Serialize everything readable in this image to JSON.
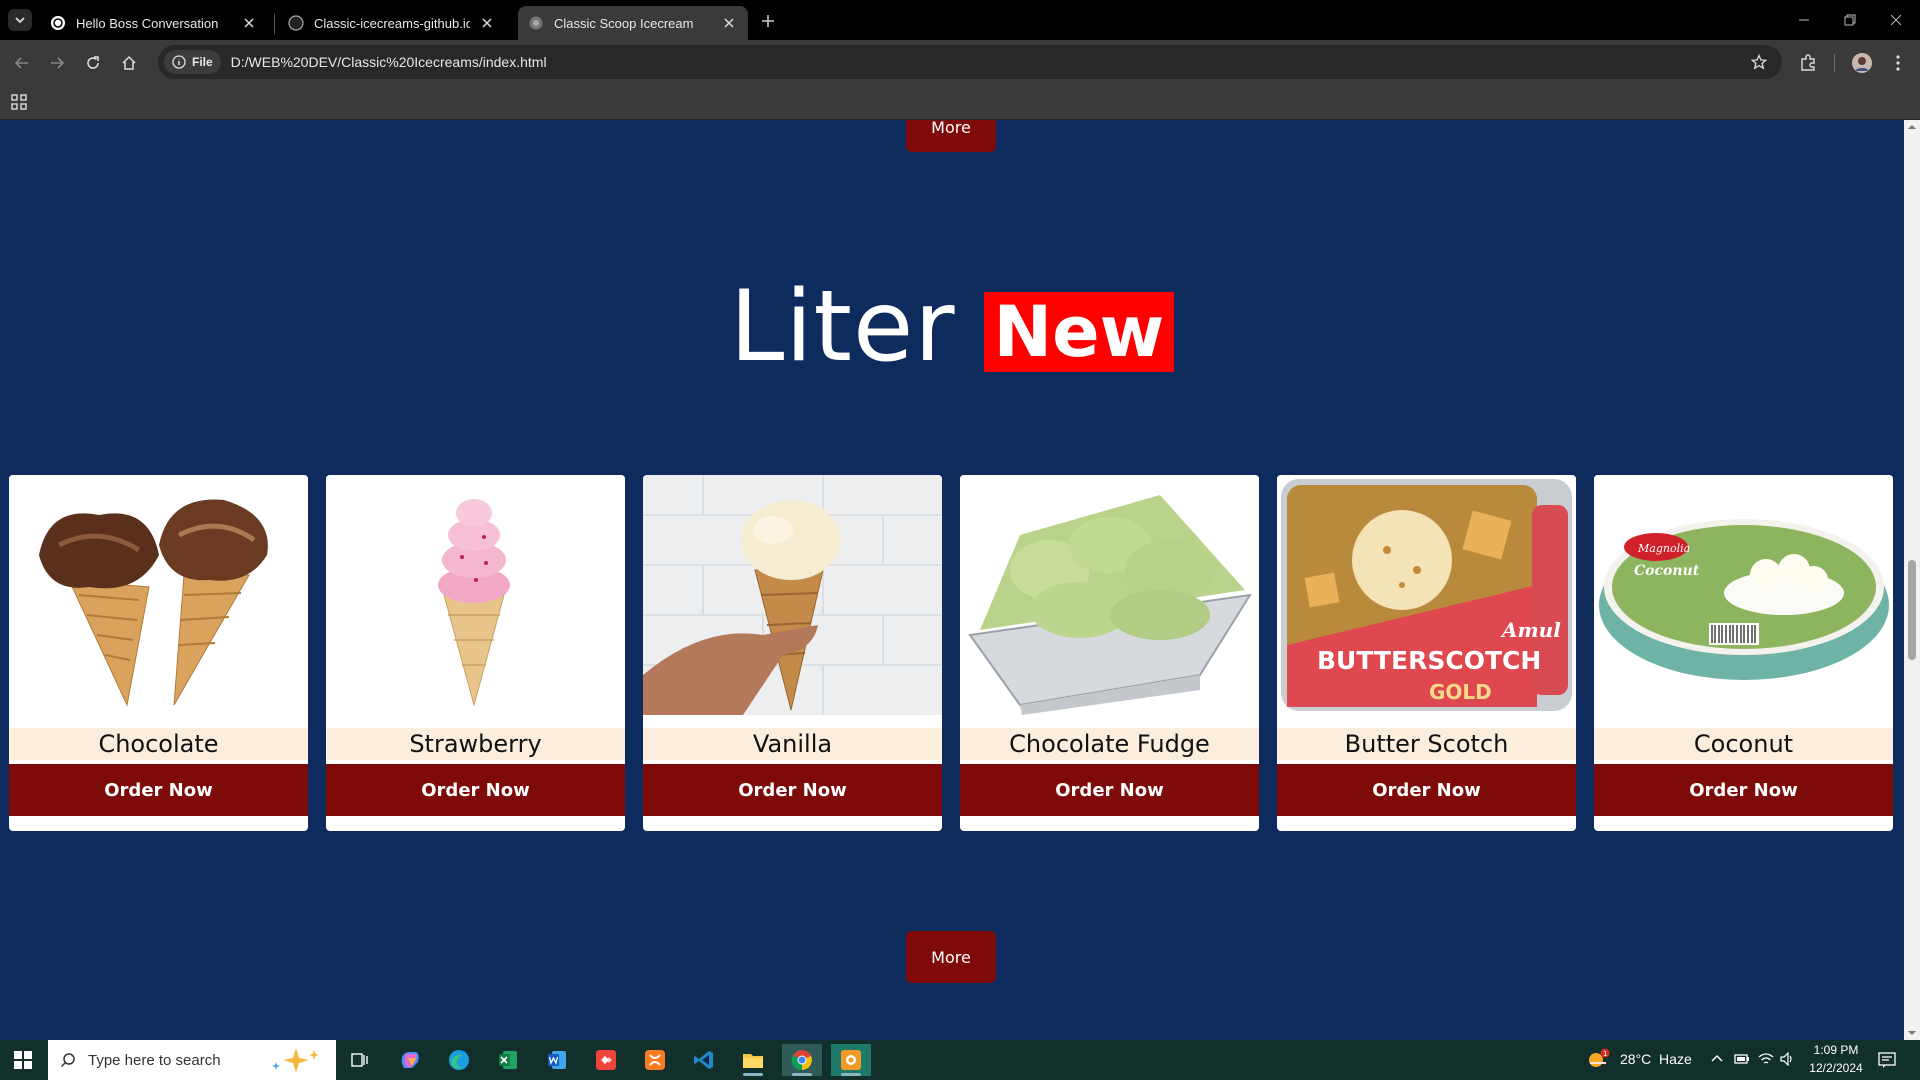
{
  "browser": {
    "tabs": [
      {
        "title": "Hello Boss Conversation",
        "favicon": "chatgpt-icon",
        "active": false
      },
      {
        "title": "Classic-icecreams-github.io/RE/",
        "favicon": "github-icon",
        "active": false
      },
      {
        "title": "Classic Scoop Icecream",
        "favicon": "globe-icon",
        "active": true
      }
    ],
    "site_chip": "File",
    "url": "D:/WEB%20DEV/Classic%20Icecreams/index.html"
  },
  "page": {
    "more_top_label": "More",
    "heading_word": "Liter",
    "heading_badge": "New",
    "order_label": "Order Now",
    "products": [
      {
        "name": "Chocolate"
      },
      {
        "name": "Strawberry"
      },
      {
        "name": "Vanilla"
      },
      {
        "name": "Chocolate Fudge"
      },
      {
        "name": "Butter Scotch"
      },
      {
        "name": "Coconut"
      }
    ],
    "butterscotch_pack_text": {
      "brand": "Amul",
      "flavour": "BUTTERSCOTCH",
      "line": "GOLD"
    },
    "coconut_pack_text": {
      "brand": "Magnolia",
      "flavour": "Coconut"
    },
    "more_bottom_label": "More",
    "colors": {
      "background": "#0d2b5c",
      "button": "#7f0a0a",
      "badge": "#ff0000",
      "name_strip": "#fbeedd"
    }
  },
  "taskbar": {
    "search_placeholder": "Type here to search",
    "weather": "28°C  Haze",
    "time": "1:09 PM",
    "date": "12/2/2024",
    "apps": [
      "task-view-icon",
      "copilot-icon",
      "edge-icon",
      "excel-icon",
      "word-icon",
      "anydesk-icon",
      "xampp-icon",
      "vscode-icon",
      "file-explorer-icon",
      "chrome-icon",
      "blender-icon"
    ]
  }
}
